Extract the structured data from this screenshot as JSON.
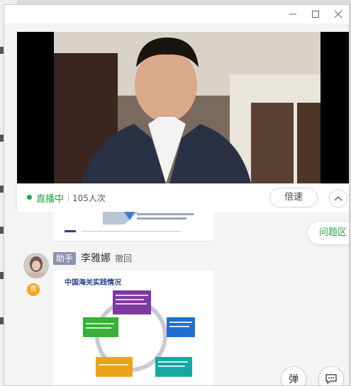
{
  "window": {
    "minimize_icon": "minimize-icon",
    "maximize_icon": "maximize-icon",
    "close_icon": "close-icon"
  },
  "status": {
    "live_label": "直播中",
    "viewers": "105人次",
    "speed_label": "倍速",
    "collapse_icon": "chevron-up-icon"
  },
  "message": {
    "role": "助手",
    "sender": "李雅娜",
    "revoke_label": "撤回",
    "vip_label": "贵",
    "slide": {
      "title": "中国海关实践情况"
    }
  },
  "side": {
    "qa_label": "问题区",
    "danmaku_label": "弹",
    "chat_icon": "chat-bubble-icon"
  }
}
